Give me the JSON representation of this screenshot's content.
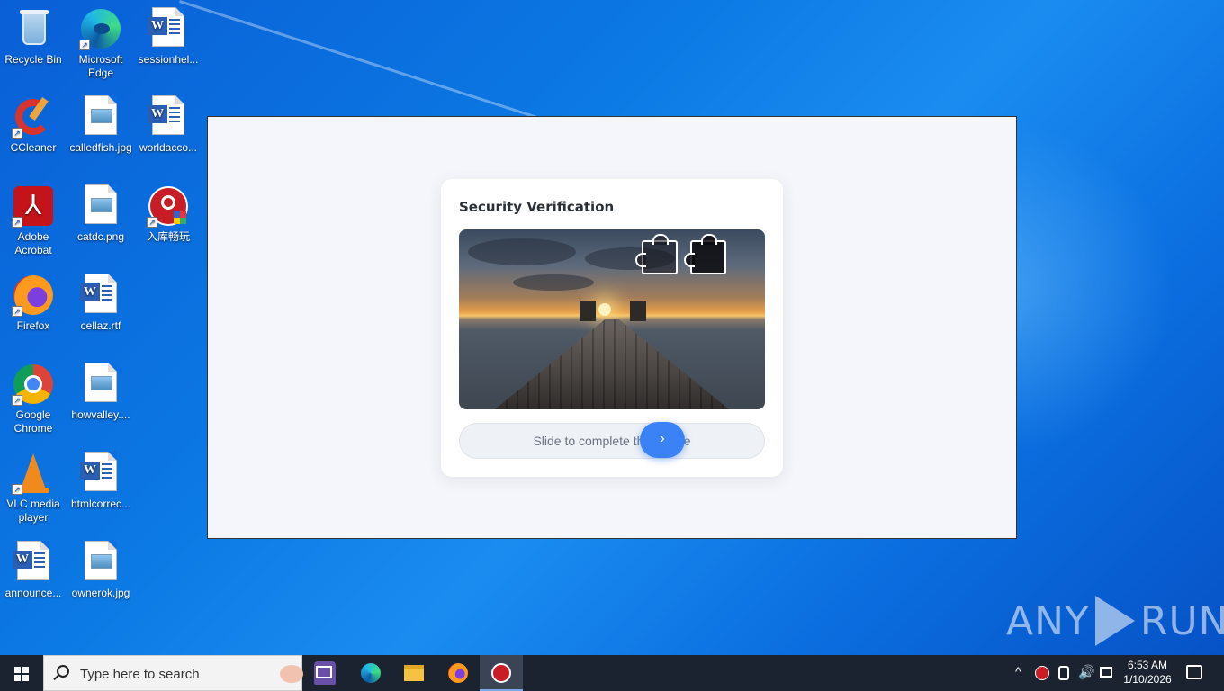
{
  "desktop": {
    "icons": [
      {
        "label": "Recycle Bin",
        "icon": "recycle-bin-icon"
      },
      {
        "label": "Microsoft Edge",
        "icon": "edge-icon"
      },
      {
        "label": "sessionhel...",
        "icon": "word-doc-icon"
      },
      {
        "label": "CCleaner",
        "icon": "ccleaner-icon"
      },
      {
        "label": "calledfish.jpg",
        "icon": "image-file-icon"
      },
      {
        "label": "worldacco...",
        "icon": "word-doc-icon"
      },
      {
        "label": "Adobe Acrobat",
        "icon": "acrobat-icon"
      },
      {
        "label": "catdc.png",
        "icon": "image-file-icon"
      },
      {
        "label": "入库畅玩",
        "icon": "steam-app-icon"
      },
      {
        "label": "Firefox",
        "icon": "firefox-icon"
      },
      {
        "label": "cellaz.rtf",
        "icon": "word-doc-icon"
      },
      {
        "label": "Google Chrome",
        "icon": "chrome-icon"
      },
      {
        "label": "howvalley....",
        "icon": "image-file-icon"
      },
      {
        "label": "VLC media player",
        "icon": "vlc-icon"
      },
      {
        "label": "htmlcorrec...",
        "icon": "word-doc-icon"
      },
      {
        "label": "announce...",
        "icon": "word-doc-icon"
      },
      {
        "label": "ownerok.jpg",
        "icon": "image-file-icon"
      }
    ]
  },
  "verification": {
    "title": "Security Verification",
    "slider_text": "Slide to complete the puzzle",
    "handle_glyph": "›",
    "accent_color": "#3b82f6"
  },
  "watermark": {
    "left": "ANY",
    "right": "RUN"
  },
  "taskbar": {
    "search_placeholder": "Type here to search",
    "apps": [
      "task-view-icon",
      "edge-icon",
      "file-explorer-icon",
      "firefox-icon",
      "steam-icon"
    ],
    "clock_time": "6:53 AM",
    "clock_date": "1/10/2026"
  }
}
